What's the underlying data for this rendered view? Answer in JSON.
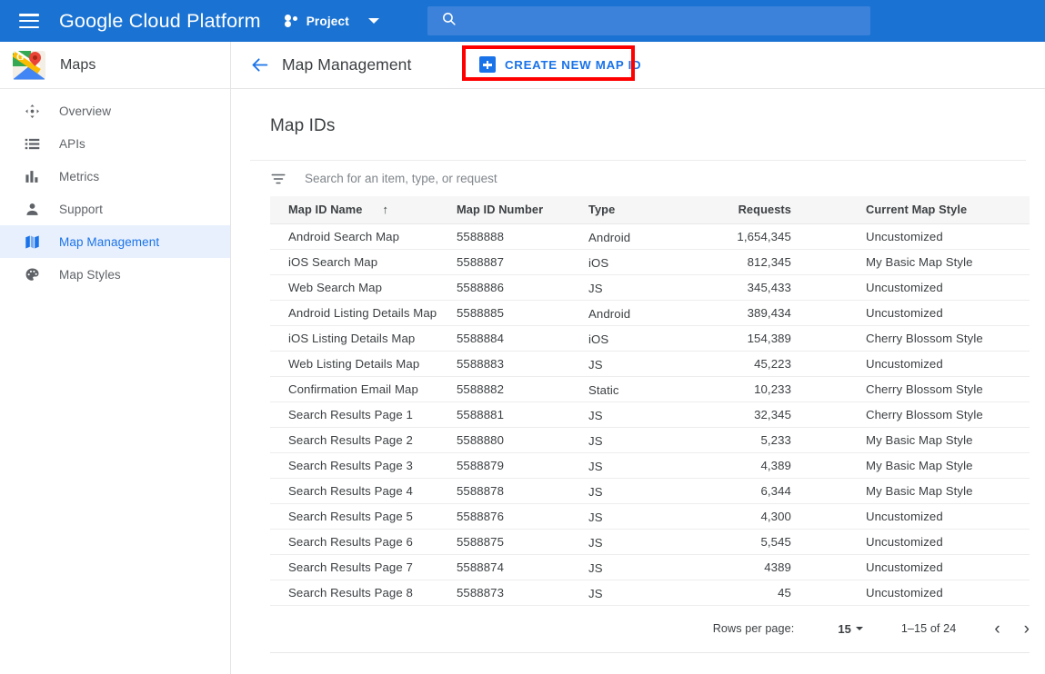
{
  "topbar": {
    "menu_icon": "hamburger-icon",
    "brand_google": "Google",
    "brand_rest": "Cloud Platform",
    "project_label": "Project",
    "project_icon": "project-dots-icon",
    "dropdown_icon": "chevron-down-icon",
    "search_icon": "search-icon",
    "search_value": "",
    "search_placeholder": "",
    "background_color": "#1a73d2"
  },
  "sidebar": {
    "product_title": "Maps",
    "product_icon": "google-maps-logo",
    "active_color": "#1a73e8",
    "active_bg": "#e8f0fe",
    "items": [
      {
        "label": "Overview",
        "icon": "move-arrows-icon",
        "active": false
      },
      {
        "label": "APIs",
        "icon": "list-icon",
        "active": false
      },
      {
        "label": "Metrics",
        "icon": "bar-chart-icon",
        "active": false
      },
      {
        "label": "Support",
        "icon": "person-icon",
        "active": false
      },
      {
        "label": "Map Management",
        "icon": "map-icon",
        "active": true
      },
      {
        "label": "Map Styles",
        "icon": "palette-icon",
        "active": false
      }
    ]
  },
  "page": {
    "back_icon": "back-arrow-icon",
    "title": "Map Management",
    "create_button_label": "CREATE NEW MAP ID",
    "create_button_icon": "plus-square-icon",
    "highlight_color": "#ff0000"
  },
  "panel": {
    "title": "Map IDs",
    "filter_icon": "filter-funnel-icon",
    "filter_value": "",
    "filter_placeholder": "Search for an item, type, or request"
  },
  "table": {
    "sort_icon": "sort-ascending-arrow",
    "sorted_column": "Map ID Name",
    "columns": [
      "Map ID Name",
      "Map ID Number",
      "Type",
      "Requests",
      "Current Map Style"
    ],
    "rows": [
      {
        "name": "Android Search Map",
        "number": "5588888",
        "type": "Android",
        "requests": "1,654,345",
        "style": "Uncustomized"
      },
      {
        "name": "iOS Search Map",
        "number": "5588887",
        "type": "iOS",
        "requests": "812,345",
        "style": "My Basic Map Style"
      },
      {
        "name": "Web Search Map",
        "number": "5588886",
        "type": "JS",
        "requests": "345,433",
        "style": "Uncustomized"
      },
      {
        "name": "Android Listing Details Map",
        "number": "5588885",
        "type": "Android",
        "requests": "389,434",
        "style": "Uncustomized"
      },
      {
        "name": "iOS Listing Details Map",
        "number": "5588884",
        "type": "iOS",
        "requests": "154,389",
        "style": "Cherry Blossom Style"
      },
      {
        "name": "Web Listing Details Map",
        "number": "5588883",
        "type": "JS",
        "requests": "45,223",
        "style": "Uncustomized"
      },
      {
        "name": "Confirmation Email Map",
        "number": "5588882",
        "type": "Static",
        "requests": "10,233",
        "style": "Cherry Blossom Style"
      },
      {
        "name": "Search Results Page 1",
        "number": "5588881",
        "type": "JS",
        "requests": "32,345",
        "style": "Cherry Blossom Style"
      },
      {
        "name": "Search Results Page 2",
        "number": "5588880",
        "type": "JS",
        "requests": "5,233",
        "style": "My Basic Map Style"
      },
      {
        "name": "Search Results Page 3",
        "number": "5588879",
        "type": "JS",
        "requests": "4,389",
        "style": "My Basic Map Style"
      },
      {
        "name": "Search Results Page 4",
        "number": "5588878",
        "type": "JS",
        "requests": "6,344",
        "style": "My Basic Map Style"
      },
      {
        "name": "Search Results Page 5",
        "number": "5588876",
        "type": "JS",
        "requests": "4,300",
        "style": "Uncustomized"
      },
      {
        "name": "Search Results Page 6",
        "number": "5588875",
        "type": "JS",
        "requests": "5,545",
        "style": "Uncustomized"
      },
      {
        "name": "Search Results Page 7",
        "number": "5588874",
        "type": "JS",
        "requests": "4389",
        "style": "Uncustomized"
      },
      {
        "name": "Search Results Page 8",
        "number": "5588873",
        "type": "JS",
        "requests": "45",
        "style": "Uncustomized"
      }
    ]
  },
  "pagination": {
    "rows_per_page_label": "Rows per page:",
    "rows_per_page_value": "15",
    "range_label": "1–15 of 24",
    "prev_icon": "chevron-left-icon",
    "prev_glyph": "‹",
    "next_icon": "chevron-right-icon",
    "next_glyph": "›"
  }
}
